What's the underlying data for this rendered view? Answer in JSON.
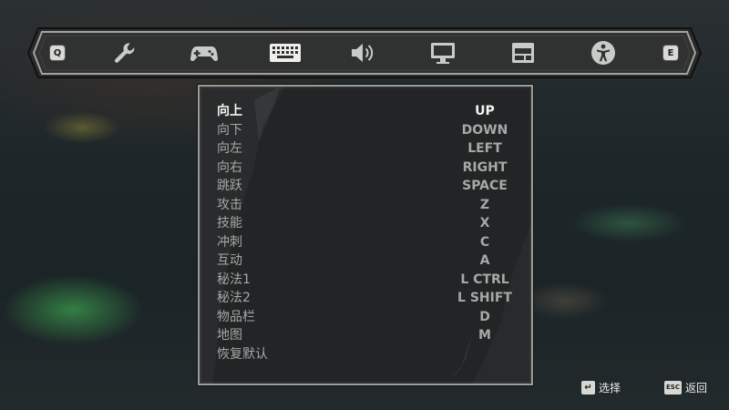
{
  "tabbar": {
    "prev_key": "Q",
    "next_key": "E",
    "tabs": [
      {
        "icon": "wrench-icon"
      },
      {
        "icon": "gamepad-icon"
      },
      {
        "icon": "keyboard-icon",
        "active": true
      },
      {
        "icon": "speaker-icon"
      },
      {
        "icon": "monitor-icon"
      },
      {
        "icon": "window-icon"
      },
      {
        "icon": "accessibility-icon"
      }
    ]
  },
  "bindings": [
    {
      "action": "向上",
      "key": "UP"
    },
    {
      "action": "向下",
      "key": "DOWN"
    },
    {
      "action": "向左",
      "key": "LEFT"
    },
    {
      "action": "向右",
      "key": "RIGHT"
    },
    {
      "action": "跳跃",
      "key": "SPACE"
    },
    {
      "action": "攻击",
      "key": "Z"
    },
    {
      "action": "技能",
      "key": "X"
    },
    {
      "action": "冲刺",
      "key": "C"
    },
    {
      "action": "互动",
      "key": "A"
    },
    {
      "action": "秘法1",
      "key": "L CTRL"
    },
    {
      "action": "秘法2",
      "key": "L SHIFT"
    },
    {
      "action": "物品栏",
      "key": "D"
    },
    {
      "action": "地图",
      "key": "M"
    },
    {
      "action": "恢复默认",
      "key": ""
    }
  ],
  "hints": {
    "confirm_key": "↵",
    "confirm_label": "选择",
    "back_key": "ESC",
    "back_label": "返回"
  },
  "colors": {
    "active_text": "#f4f4f2",
    "inactive_text": "#a7a9a8",
    "panel_bg": "#222425",
    "frame": "#9b9d98"
  }
}
